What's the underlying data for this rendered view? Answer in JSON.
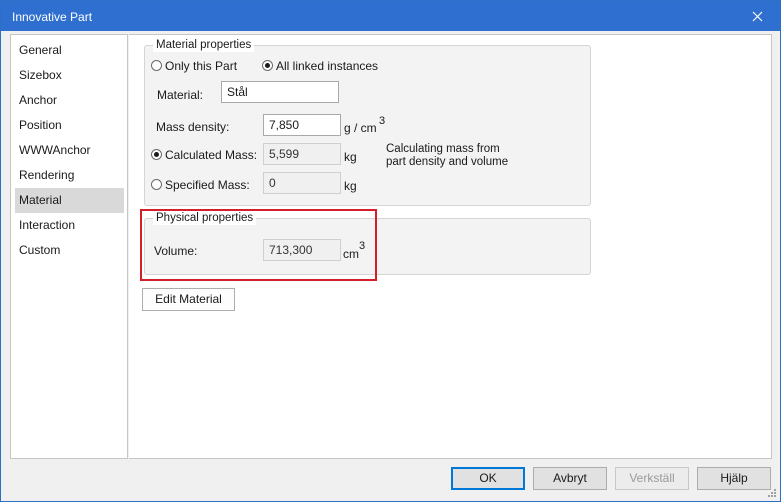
{
  "window": {
    "title": "Innovative Part"
  },
  "nav": {
    "items": [
      {
        "label": "General"
      },
      {
        "label": "Sizebox"
      },
      {
        "label": "Anchor"
      },
      {
        "label": "Position"
      },
      {
        "label": "WWWAnchor"
      },
      {
        "label": "Rendering"
      },
      {
        "label": "Material",
        "selected": true
      },
      {
        "label": "Interaction"
      },
      {
        "label": "Custom"
      }
    ]
  },
  "material": {
    "group_title": "Material properties",
    "scope_only_this": "Only this Part",
    "scope_all_linked": "All linked instances",
    "scope_selected": "All linked instances",
    "material_label": "Material:",
    "material_value": "Stål",
    "density_label": "Mass density:",
    "density_value": "7,850",
    "density_unit": "g / cm",
    "density_exp": "3",
    "calc_mass_label": "Calculated Mass:",
    "calc_mass_value": "5,599",
    "calc_mass_unit": "kg",
    "spec_mass_label": "Specified Mass:",
    "spec_mass_value": "0",
    "spec_mass_unit": "kg",
    "mass_mode_selected": "Calculated Mass:",
    "note": "Calculating mass from part density and volume"
  },
  "physical": {
    "group_title": "Physical properties",
    "volume_label": "Volume:",
    "volume_value": "713,300",
    "volume_unit": "cm",
    "volume_exp": "3"
  },
  "buttons": {
    "edit_material": "Edit Material",
    "ok": "OK",
    "cancel": "Avbryt",
    "apply": "Verkställ",
    "help": "Hjälp"
  },
  "colors": {
    "titlebar": "#2e6fd0",
    "highlight": "#d1202a"
  }
}
